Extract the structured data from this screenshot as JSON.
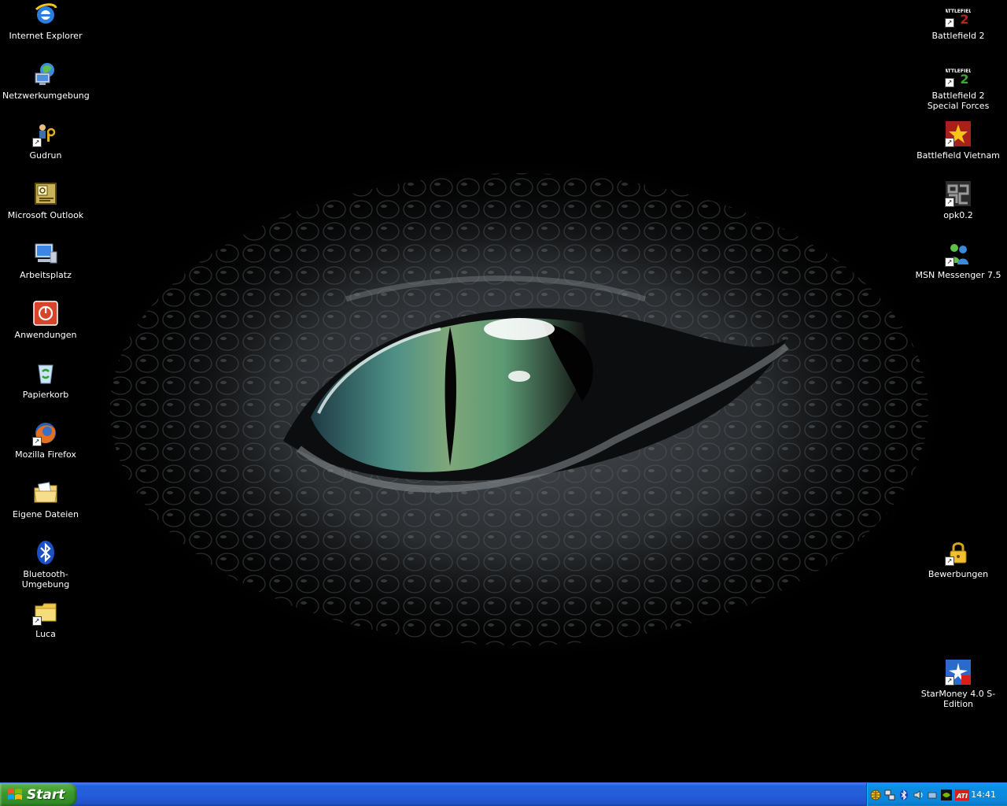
{
  "desktop": {
    "left_icons": [
      {
        "label": "Internet Explorer",
        "icon": "internet-explorer-icon"
      },
      {
        "label": "Netzwerkumgebung",
        "icon": "network-places-icon"
      },
      {
        "label": "Gudrun",
        "icon": "gudrun-shortcut-icon"
      },
      {
        "label": "Microsoft Outlook",
        "icon": "outlook-icon"
      },
      {
        "label": "Arbeitsplatz",
        "icon": "my-computer-icon"
      },
      {
        "label": "Anwendungen",
        "icon": "applications-icon"
      },
      {
        "label": "Papierkorb",
        "icon": "recycle-bin-icon"
      },
      {
        "label": "Mozilla Firefox",
        "icon": "firefox-icon"
      },
      {
        "label": "Eigene Dateien",
        "icon": "my-documents-icon"
      },
      {
        "label": "Bluetooth-Umgebung",
        "icon": "bluetooth-icon"
      },
      {
        "label": "Luca",
        "icon": "folder-shortcut-icon"
      }
    ],
    "right_icons": [
      {
        "label": "Battlefield 2",
        "icon": "battlefield2-icon"
      },
      {
        "label": "Battlefield 2 Special Forces",
        "icon": "battlefield2-sf-icon"
      },
      {
        "label": "Battlefield Vietnam",
        "icon": "battlefield-vietnam-icon"
      },
      {
        "label": "opk0.2",
        "icon": "opk-icon"
      },
      {
        "label": "MSN Messenger 7.5",
        "icon": "msn-messenger-icon"
      },
      {
        "label": "Bewerbungen",
        "icon": "locked-folder-icon"
      },
      {
        "label": "StarMoney 4.0 S-Edition",
        "icon": "starmoney-icon"
      }
    ]
  },
  "taskbar": {
    "start_label": "Start",
    "clock": "14:41",
    "tray_icons": [
      "globe-icon",
      "network-icon",
      "bluetooth-tray-icon",
      "sound-icon",
      "safely-remove-icon",
      "nvidia-icon",
      "ati-icon"
    ],
    "ati_text": "ATI"
  },
  "colors": {
    "taskbar_blue": "#245edb",
    "start_green": "#3c9a2d",
    "tray_blue": "#0b86d8",
    "eye_iris": "#4e8f7a"
  }
}
